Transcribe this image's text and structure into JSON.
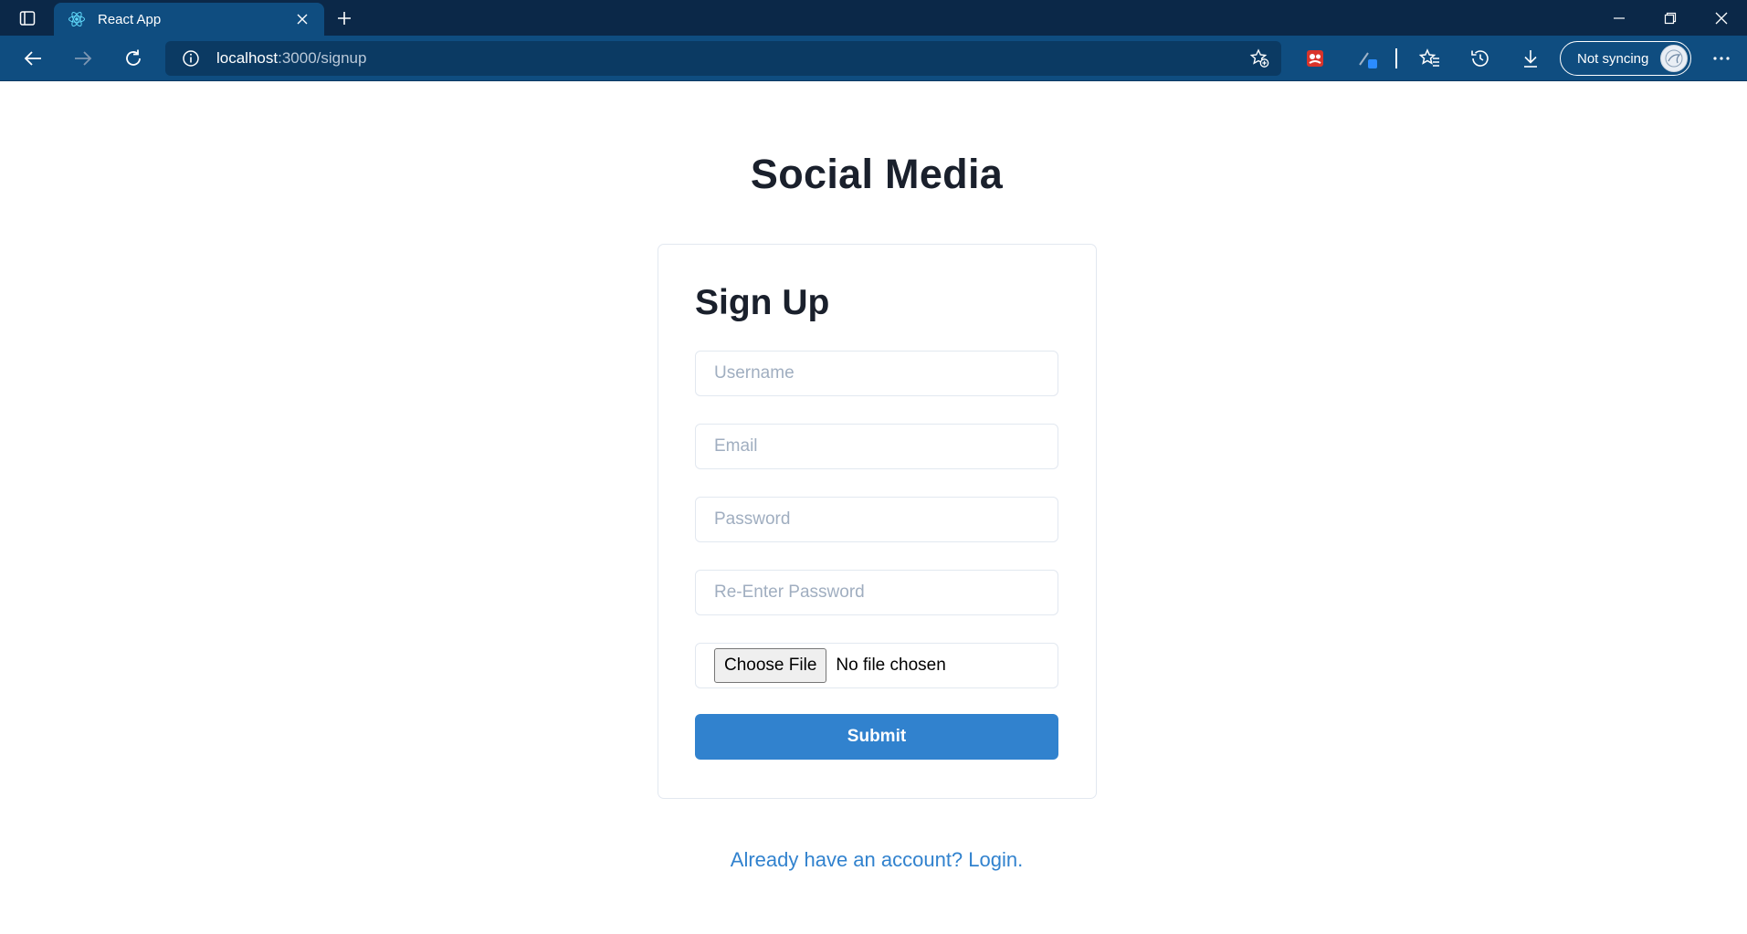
{
  "browser": {
    "tab_title": "React App",
    "url_host": "localhost",
    "url_path": ":3000/signup",
    "sync_label": "Not syncing",
    "icons": {
      "tab_actions": "tab-actions-icon",
      "favicon": "react-logo-icon",
      "close_tab": "close-icon",
      "new_tab": "plus-icon",
      "back": "back-arrow-icon",
      "forward": "forward-arrow-icon",
      "refresh": "refresh-icon",
      "site_info": "info-icon",
      "add_favorite": "star-add-icon",
      "extension": "extension-icon",
      "pen": "pen-icon",
      "favorites": "favorites-icon",
      "history": "history-icon",
      "downloads": "download-icon",
      "more": "ellipsis-icon",
      "minimize": "minimize-icon",
      "restore": "restore-icon",
      "close_window": "close-icon"
    },
    "colors": {
      "titlebar": "#0b2848",
      "toolbar": "#0f4d80",
      "addressbar": "#0b3a63"
    }
  },
  "page": {
    "app_title": "Social Media",
    "form": {
      "heading": "Sign Up",
      "username_placeholder": "Username",
      "email_placeholder": "Email",
      "password_placeholder": "Password",
      "reenter_password_placeholder": "Re-Enter Password",
      "file_button_label": "Choose File",
      "file_status": "No file chosen",
      "submit_label": "Submit"
    },
    "login_link": "Already have an account? Login.",
    "colors": {
      "primary": "#3182ce",
      "text": "#1a202c",
      "border": "#e2e8f0",
      "placeholder": "#a0aec0"
    }
  }
}
